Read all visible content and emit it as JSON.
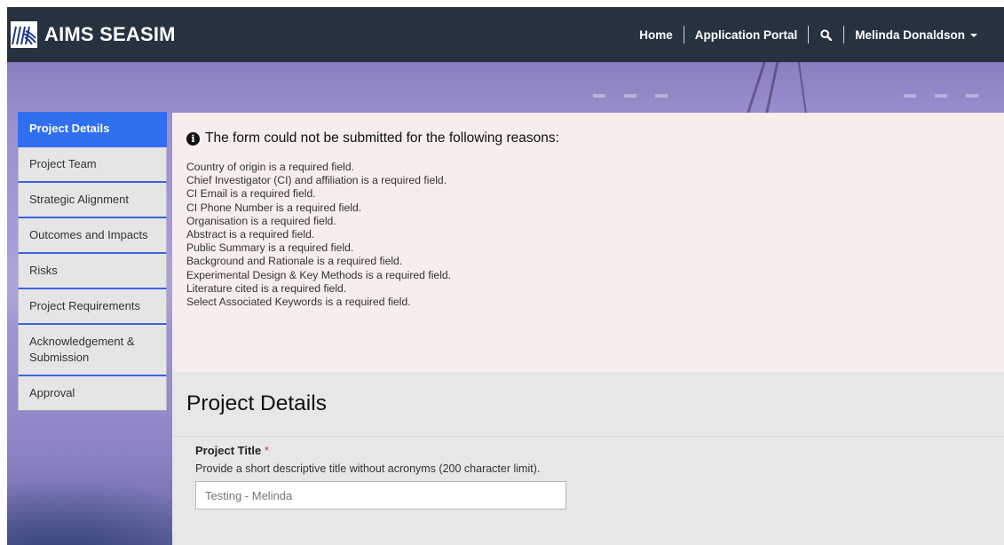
{
  "brand": {
    "name": "AIMS SEASIM"
  },
  "nav": {
    "home": "Home",
    "portal": "Application Portal",
    "user": "Melinda Donaldson"
  },
  "sidebar": {
    "items": [
      {
        "label": "Project Details"
      },
      {
        "label": "Project Team"
      },
      {
        "label": "Strategic Alignment"
      },
      {
        "label": "Outcomes and Impacts"
      },
      {
        "label": "Risks"
      },
      {
        "label": "Project Requirements"
      },
      {
        "label": "Acknowledgement & Submission"
      },
      {
        "label": "Approval"
      }
    ]
  },
  "alert": {
    "heading": "The form could not be submitted for the following reasons:",
    "errors": [
      "Country of origin is a required field.",
      "Chief Investigator (CI) and affiliation is a required field.",
      "CI Email is a required field.",
      "CI Phone Number is a required field.",
      "Organisation is a required field.",
      "Abstract is a required field.",
      "Public Summary is a required field.",
      "Background and Rationale is a required field.",
      "Experimental Design & Key Methods is a required field.",
      "Literature cited is a required field.",
      "Select Associated Keywords is a required field."
    ]
  },
  "main": {
    "title": "Project Details",
    "field": {
      "label": "Project Title",
      "required_mark": "*",
      "description": "Provide a short descriptive title without acronyms (200 character limit).",
      "value": "Testing - Melinda"
    }
  },
  "colors": {
    "navbar": "#273241",
    "active": "#2f6ff0",
    "alert_bg": "#f7eded"
  }
}
